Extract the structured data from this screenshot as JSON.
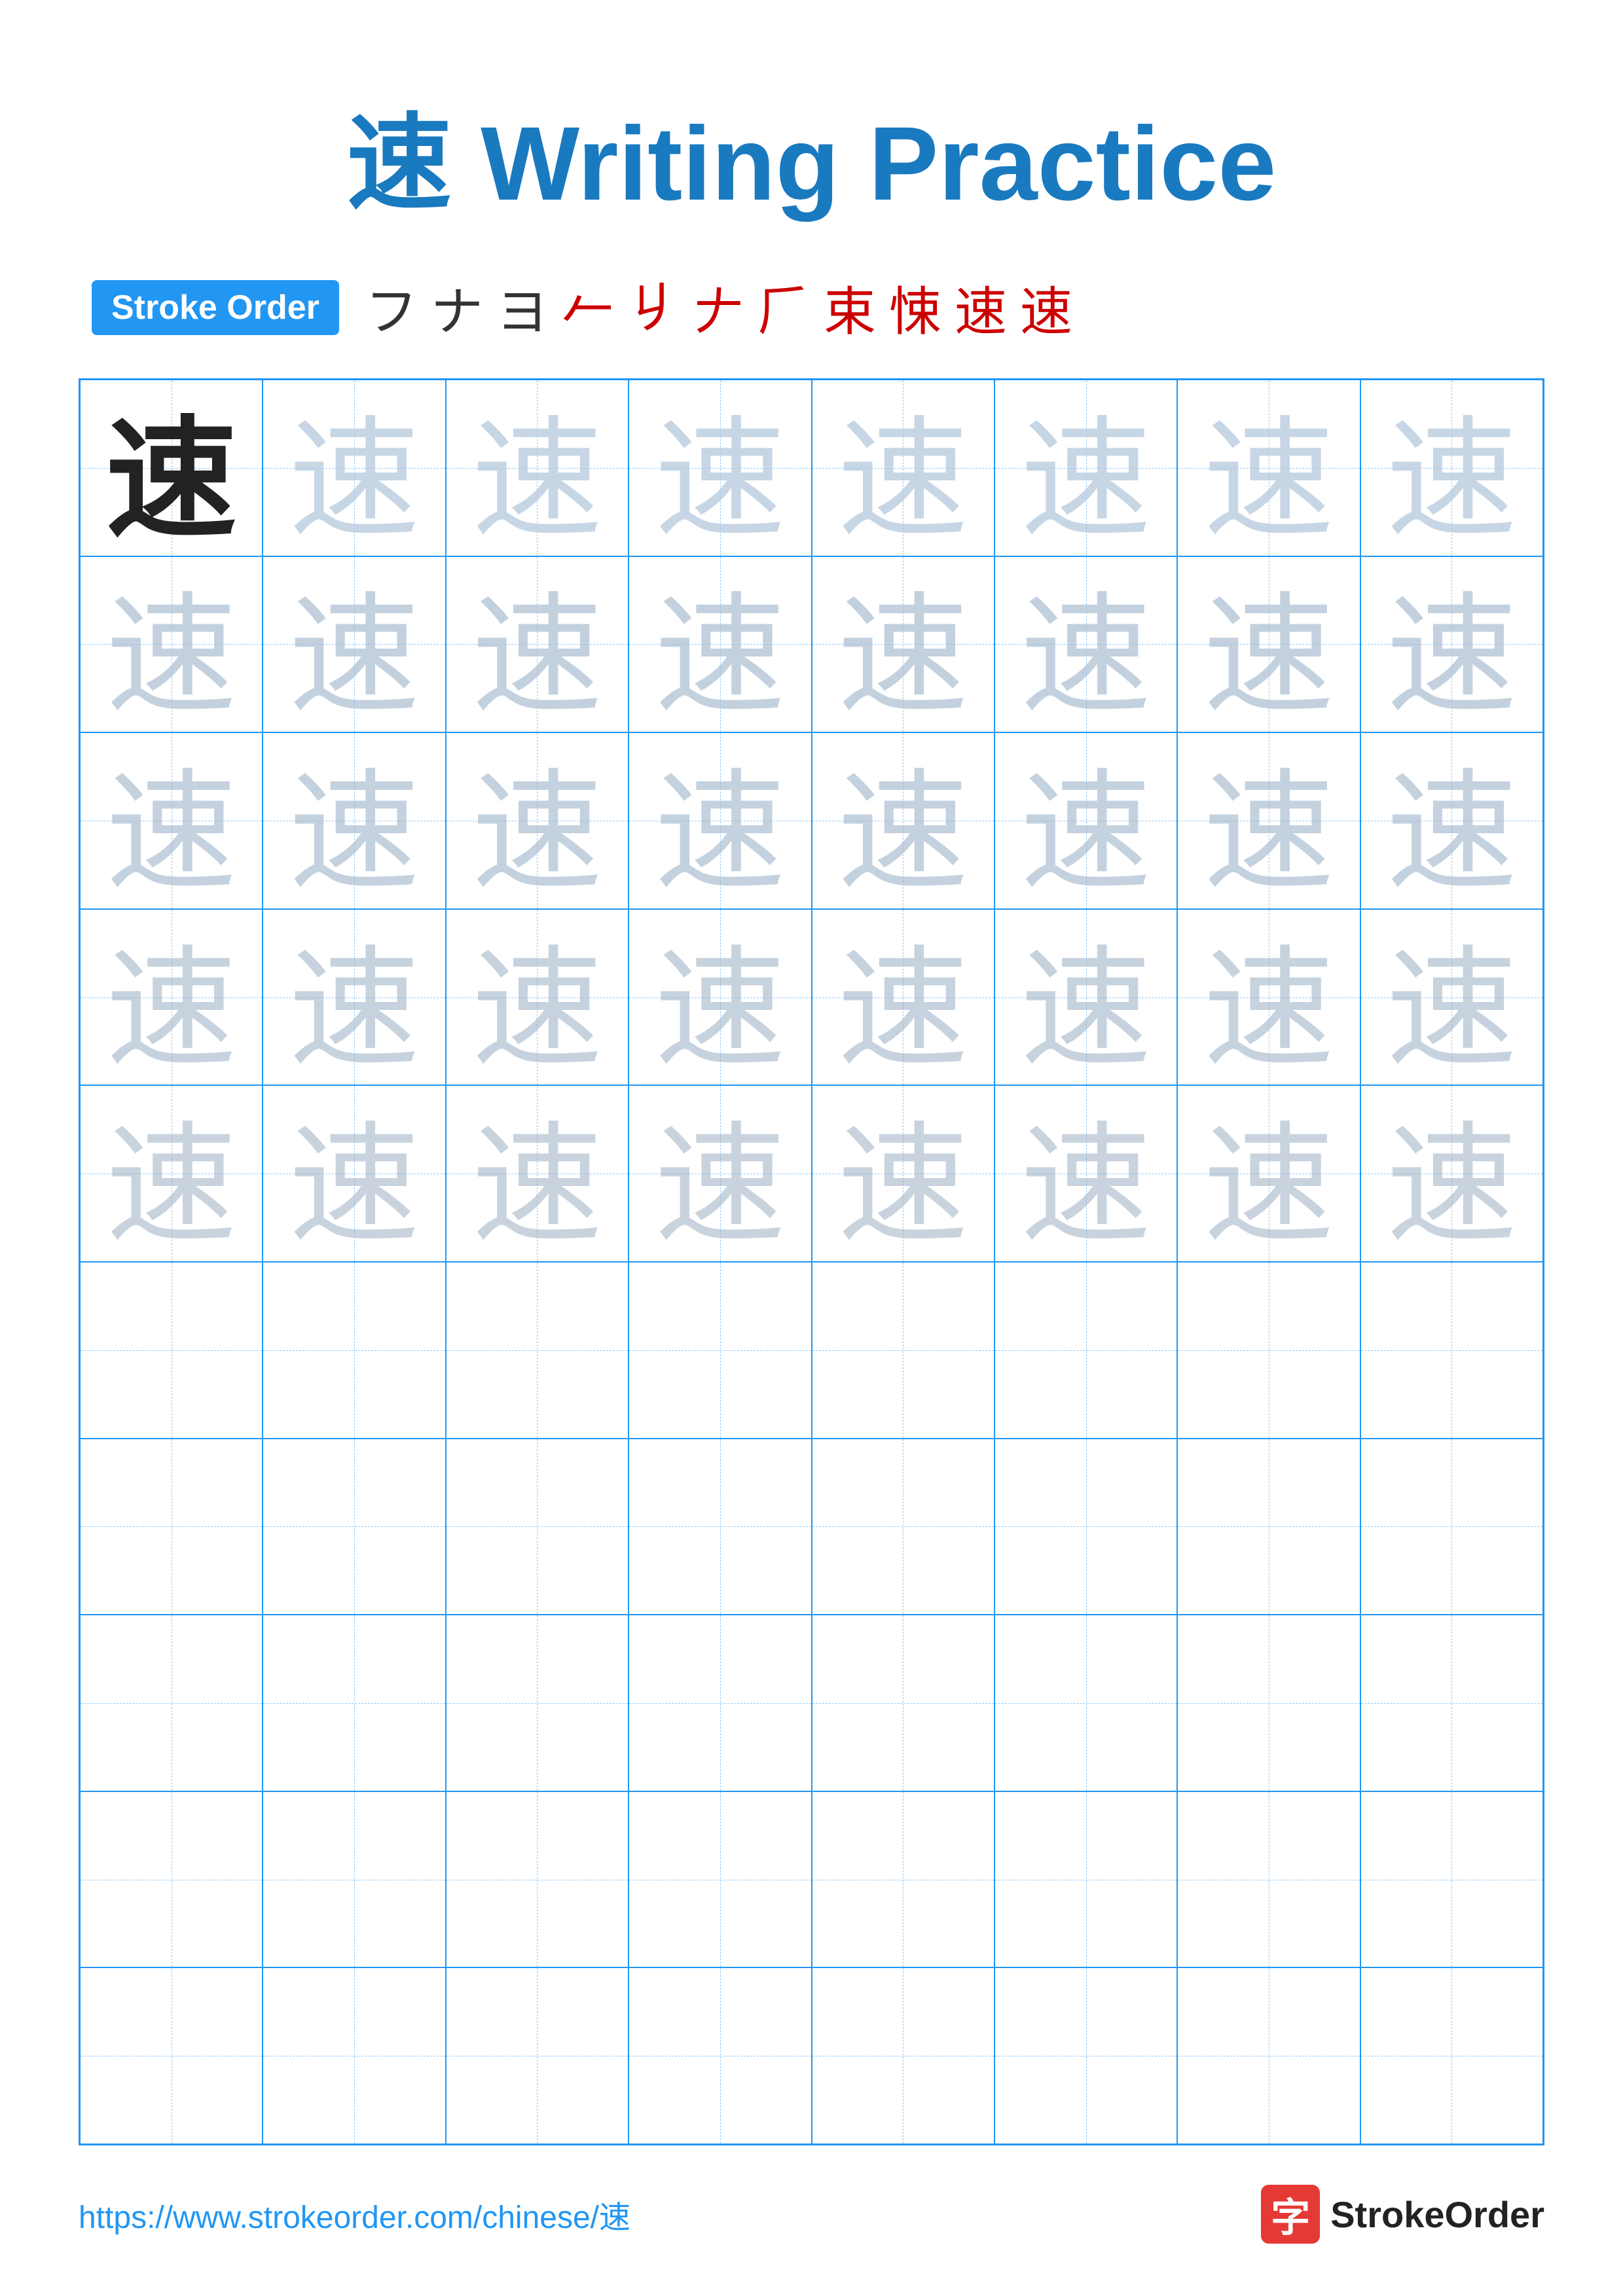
{
  "title": {
    "char": "速",
    "text": " Writing Practice",
    "full": "速 Writing Practice"
  },
  "stroke_order": {
    "badge_label": "Stroke Order",
    "strokes": [
      "フ",
      "ナ",
      "ヨ",
      "𠂉",
      "𠂉",
      "𠂉",
      "𠂉",
      "束",
      "束",
      "速",
      "速"
    ],
    "stroke_chars_display": [
      "フ",
      "ナ",
      "ヨ",
      "亍",
      "亍",
      "𠂉",
      "𠂉",
      "束",
      "束",
      "速",
      "速"
    ]
  },
  "grid": {
    "cols": 8,
    "rows": 10,
    "practice_char": "速",
    "filled_rows": 5,
    "empty_rows": 5
  },
  "footer": {
    "url": "https://www.strokeorder.com/chinese/速",
    "logo_char": "字",
    "logo_text": "StrokeOrder"
  }
}
